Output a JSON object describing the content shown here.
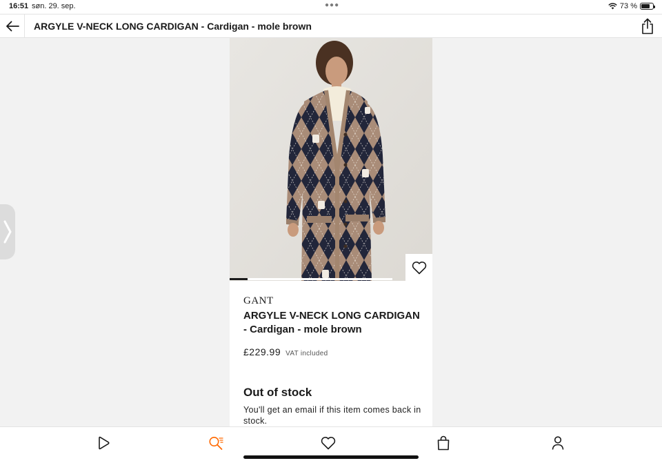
{
  "status_bar": {
    "time": "16:51",
    "date": "søn. 29. sep.",
    "battery_text": "73 %",
    "battery_level": 0.73
  },
  "header": {
    "title": "ARGYLE V-NECK LONG CARDIGAN - Cardigan - mole brown",
    "back_icon": "arrow-left-icon",
    "share_icon": "share-icon"
  },
  "product": {
    "brand": "GANT",
    "name": "ARGYLE V-NECK LONG CARDIGAN - Cardigan - mole brown",
    "price": "£229.99",
    "vat_note": "VAT included",
    "gallery_progress": 0.11,
    "stock_title": "Out of stock",
    "stock_message": "You'll get an email if this item comes back in stock."
  },
  "colors": {
    "accent": "#ff6900",
    "text": "#1a1a1a",
    "page_bg": "#f2f2f2"
  },
  "tabbar": {
    "items": [
      {
        "name": "discover",
        "icon": "play-icon"
      },
      {
        "name": "search",
        "icon": "search-icon",
        "active": true
      },
      {
        "name": "wishlist",
        "icon": "heart-icon"
      },
      {
        "name": "bag",
        "icon": "bag-icon"
      },
      {
        "name": "account",
        "icon": "person-icon"
      }
    ]
  }
}
